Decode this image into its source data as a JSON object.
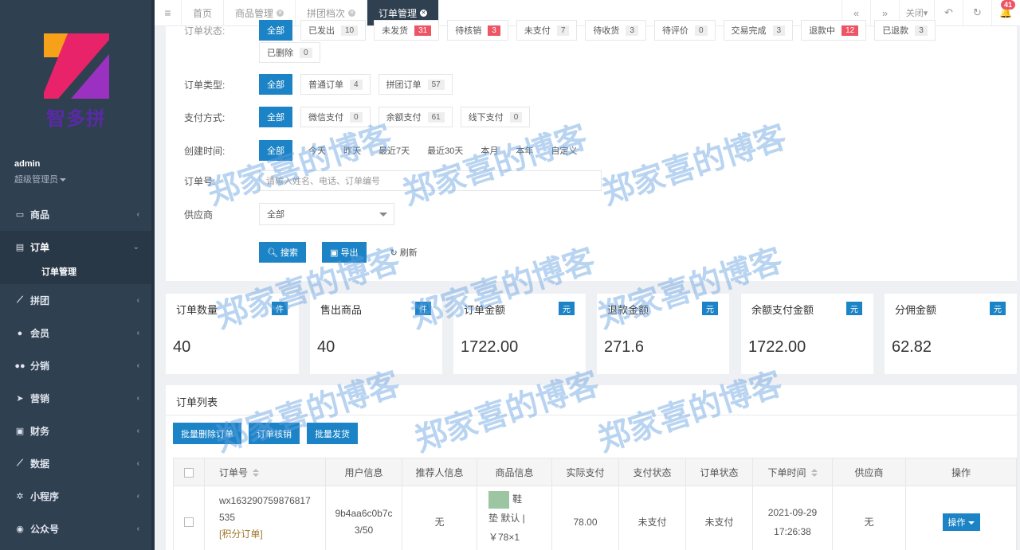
{
  "sidebar": {
    "logo_text": "智多拼",
    "user": "admin",
    "role": "超级管理员",
    "menu": [
      {
        "label": "商品",
        "icon": "monitor-icon"
      },
      {
        "label": "订单",
        "icon": "document-icon"
      },
      {
        "label": "拼团",
        "icon": "chart-icon"
      },
      {
        "label": "会员",
        "icon": "user-icon"
      },
      {
        "label": "分销",
        "icon": "users-icon"
      },
      {
        "label": "营销",
        "icon": "send-icon"
      },
      {
        "label": "财务",
        "icon": "money-icon"
      },
      {
        "label": "数据",
        "icon": "area-chart-icon"
      },
      {
        "label": "小程序",
        "icon": "share-icon"
      },
      {
        "label": "公众号",
        "icon": "wechat-icon"
      }
    ],
    "submenu": "订单管理"
  },
  "topbar": {
    "tabs": [
      {
        "label": "首页"
      },
      {
        "label": "商品管理"
      },
      {
        "label": "拼团档次"
      },
      {
        "label": "订单管理"
      }
    ],
    "close_label": "关闭",
    "notification_count": "41"
  },
  "filters": {
    "row0": [
      {
        "label": "全部"
      },
      {
        "label": "已发出",
        "count": "10"
      },
      {
        "label": "未发货",
        "count": "31"
      },
      {
        "label": "待核销",
        "count": "3"
      },
      {
        "label": "未支付",
        "count": "7"
      },
      {
        "label": "待收货",
        "count": "3"
      },
      {
        "label": "待评价",
        "count": "0"
      },
      {
        "label": "交易完成",
        "count": "3"
      },
      {
        "label": "退款中",
        "count": "12"
      },
      {
        "label": "已退款",
        "count": "3"
      }
    ],
    "deleted": {
      "label": "已删除",
      "count": "0"
    },
    "order_type": {
      "label": "订单类型:",
      "options": [
        {
          "label": "全部"
        },
        {
          "label": "普通订单",
          "count": "4"
        },
        {
          "label": "拼团订单",
          "count": "57"
        }
      ]
    },
    "pay_method": {
      "label": "支付方式:",
      "options": [
        {
          "label": "全部"
        },
        {
          "label": "微信支付",
          "count": "0"
        },
        {
          "label": "余额支付",
          "count": "61"
        },
        {
          "label": "线下支付",
          "count": "0"
        }
      ]
    },
    "created_time": {
      "label": "创建时间:",
      "options": [
        "全部",
        "今天",
        "昨天",
        "最近7天",
        "最近30天",
        "本月",
        "本年",
        "自定义"
      ]
    },
    "order_no": {
      "label": "订单号:",
      "placeholder": "请输入姓名、电话、订单编号"
    },
    "supplier": {
      "label": "供应商",
      "value": "全部"
    },
    "search_btn": "搜索",
    "export_btn": "导出",
    "refresh_btn": "刷新"
  },
  "stats": [
    {
      "label": "订单数量",
      "unit": "件",
      "value": "40"
    },
    {
      "label": "售出商品",
      "unit": "件",
      "value": "40"
    },
    {
      "label": "订单金额",
      "unit": "元",
      "value": "1722.00"
    },
    {
      "label": "退款金额",
      "unit": "元",
      "value": "271.6"
    },
    {
      "label": "余额支付金额",
      "unit": "元",
      "value": "1722.00"
    },
    {
      "label": "分佣金额",
      "unit": "元",
      "value": "62.82"
    }
  ],
  "list": {
    "title": "订单列表",
    "actions": [
      "批量删除订单",
      "订单核销",
      "批量发货"
    ],
    "columns": [
      "订单号",
      "用户信息",
      "推荐人信息",
      "商品信息",
      "实际支付",
      "支付状态",
      "订单状态",
      "下单时间",
      "供应商",
      "操作"
    ],
    "rows": [
      {
        "order_no_1": "wx163290759876817",
        "order_no_2": "535",
        "order_tag": "[积分订单]",
        "user_1": "9b4aa6c0b7c",
        "user_2": "3/50",
        "referrer": "无",
        "product_1": "鞋",
        "product_2": "垫 默认 |",
        "product_3": "￥78×1",
        "paid": "78.00",
        "pay_status": "未支付",
        "order_status": "未支付",
        "time_1": "2021-09-29",
        "time_2": "17:26:38",
        "supplier": "无",
        "op": "操作"
      }
    ]
  },
  "watermark": "郑家喜的博客"
}
